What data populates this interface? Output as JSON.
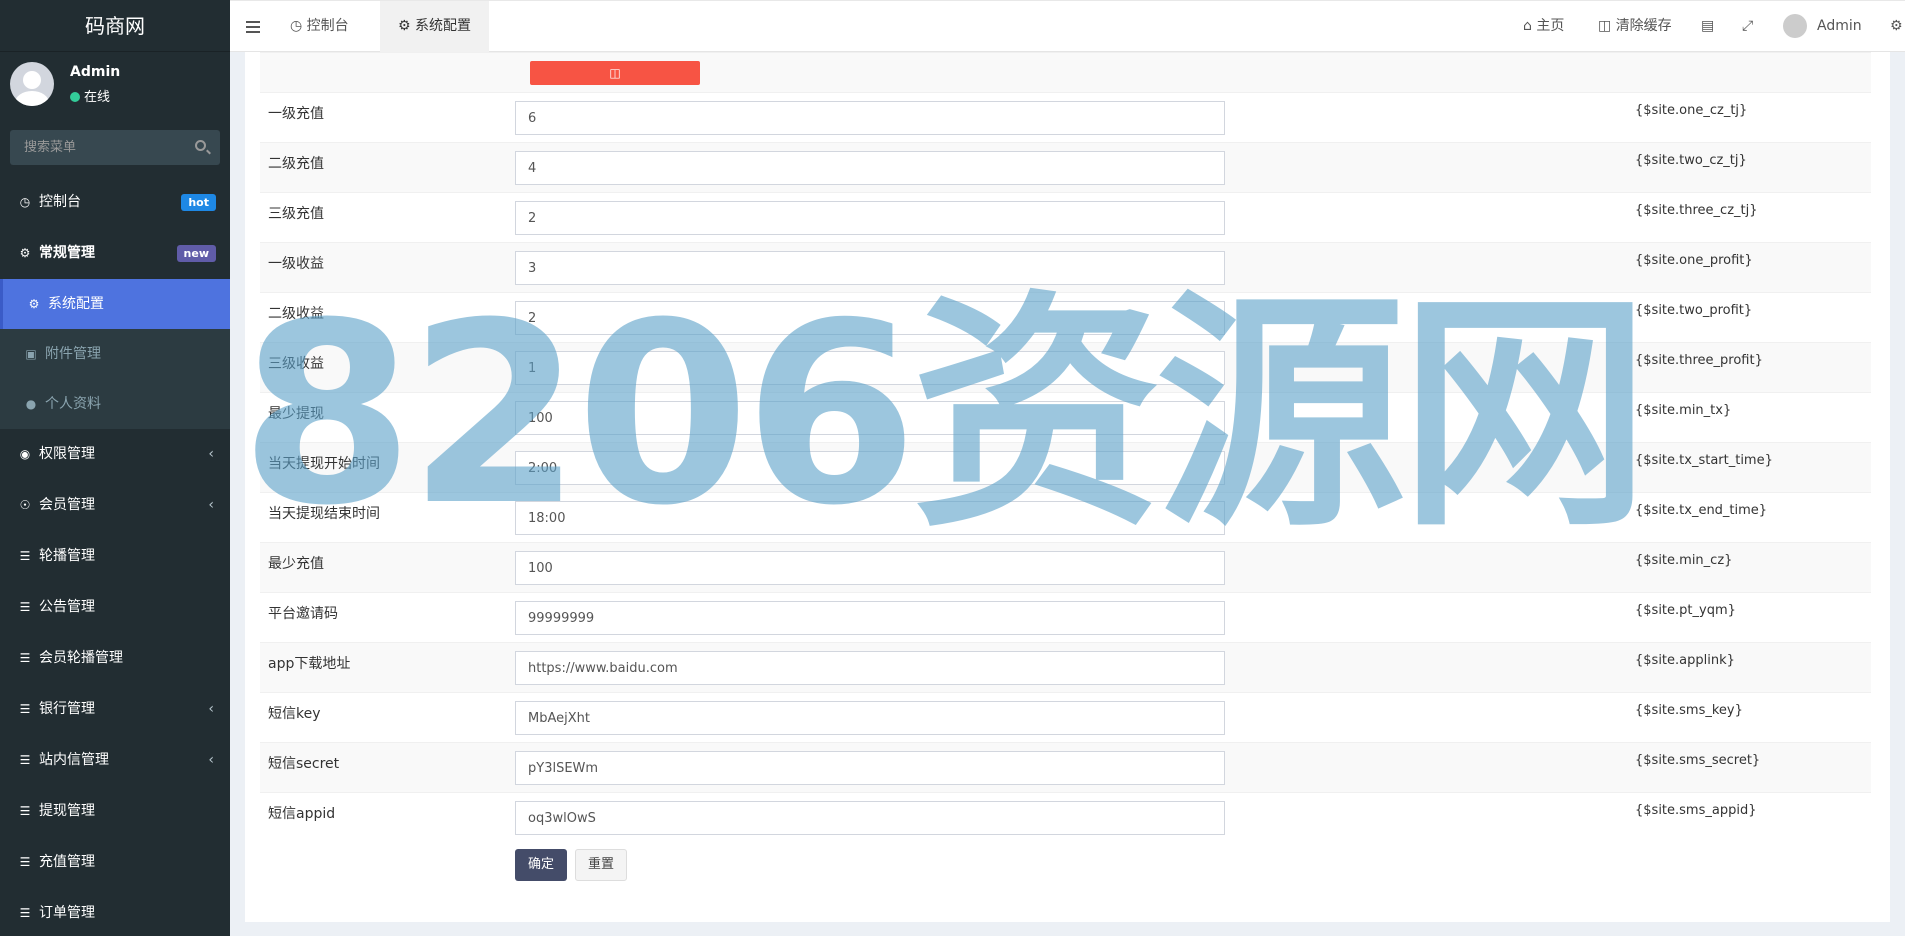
{
  "sidebar": {
    "logo": "码商网",
    "user_name": "Admin",
    "user_status": "在线",
    "search_placeholder": "搜索菜单",
    "items": [
      {
        "label": "控制台",
        "badge": "hot"
      },
      {
        "label": "常规管理",
        "badge": "new"
      },
      {
        "label": "系统配置"
      },
      {
        "label": "附件管理"
      },
      {
        "label": "个人资料"
      },
      {
        "label": "权限管理"
      },
      {
        "label": "会员管理"
      },
      {
        "label": "轮播管理"
      },
      {
        "label": "公告管理"
      },
      {
        "label": "会员轮播管理"
      },
      {
        "label": "银行管理"
      },
      {
        "label": "站内信管理"
      },
      {
        "label": "提现管理"
      },
      {
        "label": "充值管理"
      },
      {
        "label": "订单管理"
      }
    ]
  },
  "topbar": {
    "tabs": [
      "控制台",
      "系统配置"
    ],
    "home": "主页",
    "clear_cache": "清除缓存",
    "user": "Admin"
  },
  "form": {
    "rows": [
      {
        "label": "一级充值",
        "value": "6",
        "var": "{$site.one_cz_tj}"
      },
      {
        "label": "二级充值",
        "value": "4",
        "var": "{$site.two_cz_tj}"
      },
      {
        "label": "三级充值",
        "value": "2",
        "var": "{$site.three_cz_tj}"
      },
      {
        "label": "一级收益",
        "value": "3",
        "var": "{$site.one_profit}"
      },
      {
        "label": "二级收益",
        "value": "2",
        "var": "{$site.two_profit}"
      },
      {
        "label": "三级收益",
        "value": "1",
        "var": "{$site.three_profit}"
      },
      {
        "label": "最少提现",
        "value": "100",
        "var": "{$site.min_tx}"
      },
      {
        "label": "当天提现开始时间",
        "value": "2:00",
        "var": "{$site.tx_start_time}"
      },
      {
        "label": "当天提现结束时间",
        "value": "18:00",
        "var": "{$site.tx_end_time}"
      },
      {
        "label": "最少充值",
        "value": "100",
        "var": "{$site.min_cz}"
      },
      {
        "label": "平台邀请码",
        "value": "99999999",
        "var": "{$site.pt_yqm}"
      },
      {
        "label": "app下载地址",
        "value": "https://www.baidu.com",
        "var": "{$site.applink}"
      },
      {
        "label": "短信key",
        "value": "MbAejXht",
        "var": "{$site.sms_key}"
      },
      {
        "label": "短信secret",
        "value": "pY3lSEWm",
        "var": "{$site.sms_secret}"
      },
      {
        "label": "短信appid",
        "value": "oq3wlOwS",
        "var": "{$site.sms_appid}"
      }
    ],
    "submit_label": "确定",
    "reset_label": "重置"
  },
  "watermark": "8206资源网"
}
